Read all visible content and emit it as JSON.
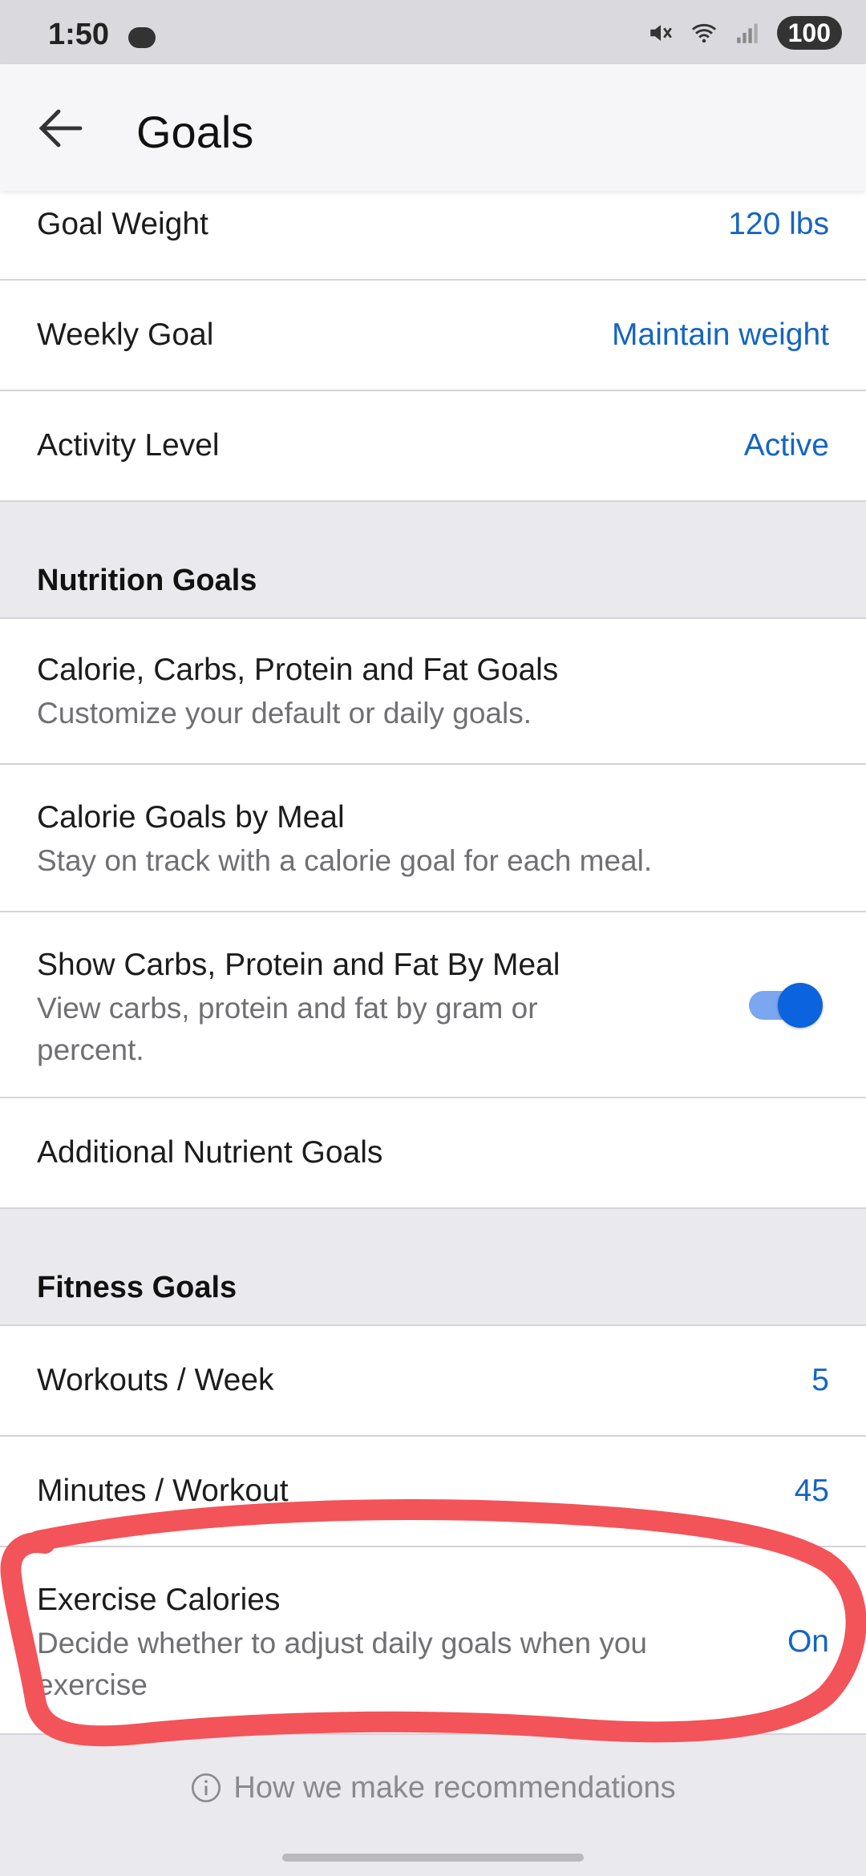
{
  "status_bar": {
    "time": "1:50",
    "battery": "100"
  },
  "header": {
    "title": "Goals"
  },
  "rows_top": [
    {
      "label": "Goal Weight",
      "value": "120 lbs"
    },
    {
      "label": "Weekly Goal",
      "value": "Maintain weight"
    },
    {
      "label": "Activity Level",
      "value": "Active"
    }
  ],
  "nutrition": {
    "title": "Nutrition Goals",
    "items": [
      {
        "label": "Calorie, Carbs, Protein and Fat Goals",
        "sub": "Customize your default or daily goals."
      },
      {
        "label": "Calorie Goals by Meal",
        "sub": "Stay on track with a calorie goal for each meal."
      },
      {
        "label": "Show Carbs, Protein and Fat By Meal",
        "sub_line1": "View carbs, protein and fat by gram or",
        "sub_line2": "percent.",
        "toggle_on": true
      },
      {
        "label": "Additional Nutrient Goals"
      }
    ]
  },
  "fitness": {
    "title": "Fitness Goals",
    "items": [
      {
        "label": "Workouts / Week",
        "value": "5"
      },
      {
        "label": "Minutes / Workout",
        "value": "45"
      },
      {
        "label": "Exercise Calories",
        "sub_line1": "Decide whether to adjust daily goals when you",
        "sub_line2": "exercise",
        "value": "On"
      }
    ]
  },
  "footer": {
    "text": "How we make recommendations"
  },
  "colors": {
    "accent": "#1565c0",
    "annotation": "#f25459"
  }
}
